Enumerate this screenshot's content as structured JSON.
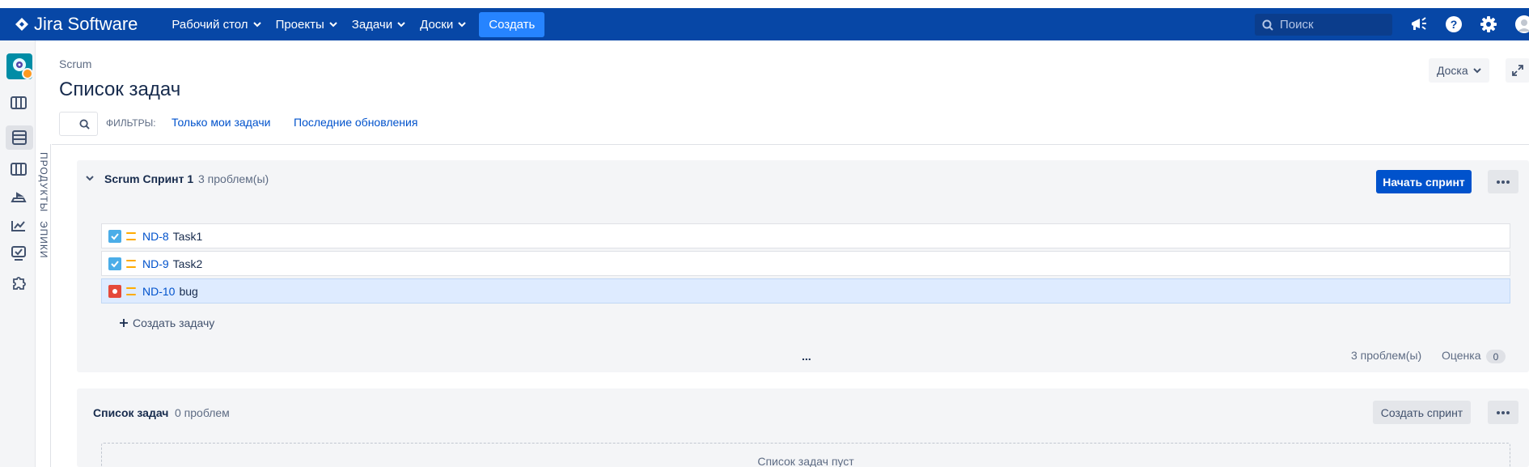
{
  "topnav": {
    "logo_text": "Jira Software",
    "items": [
      {
        "label": "Рабочий стол"
      },
      {
        "label": "Проекты"
      },
      {
        "label": "Задачи"
      },
      {
        "label": "Доски"
      }
    ],
    "create_label": "Создать",
    "search_placeholder": "Поиск",
    "icons": [
      "megaphone-icon",
      "help-icon",
      "settings-icon",
      "user-avatar"
    ],
    "bg_color": "#0747a6",
    "create_color": "#2684ff"
  },
  "sidebar": {
    "icons": [
      "project-avatar",
      "board-icon",
      "backlog-icon",
      "active-sprint-icon",
      "releases-icon",
      "reports-icon",
      "issues-icon",
      "add-ons-icon"
    ]
  },
  "side_labels": {
    "products": "ПРОДУКТЫ",
    "epics": "ЭПИКИ"
  },
  "header": {
    "breadcrumb": "Scrum",
    "title": "Список задач",
    "board_button": "Доска",
    "filters_label": "ФИЛЬТРЫ:",
    "filter_mine": "Только мои задачи",
    "filter_recent": "Последние обновления"
  },
  "sprint": {
    "name": "Scrum Спринт 1",
    "count": "3 проблем(ы)",
    "start_button": "Начать спринт",
    "issues": [
      {
        "key": "ND-8",
        "summary": "Task1",
        "type": "task",
        "priority": "medium",
        "selected": false
      },
      {
        "key": "ND-9",
        "summary": "Task2",
        "type": "task",
        "priority": "medium",
        "selected": false
      },
      {
        "key": "ND-10",
        "summary": "bug",
        "type": "bug",
        "priority": "medium",
        "selected": true
      }
    ],
    "create_issue": "Создать задачу",
    "dots": "...",
    "footer_count": "3 проблем(ы)",
    "estimate_label": "Оценка",
    "estimate_value": "0",
    "primary_color": "#0052cc"
  },
  "backlog": {
    "name": "Список задач",
    "count": "0 проблем",
    "create_sprint_button": "Создать спринт",
    "empty_text": "Список задач пуст"
  }
}
